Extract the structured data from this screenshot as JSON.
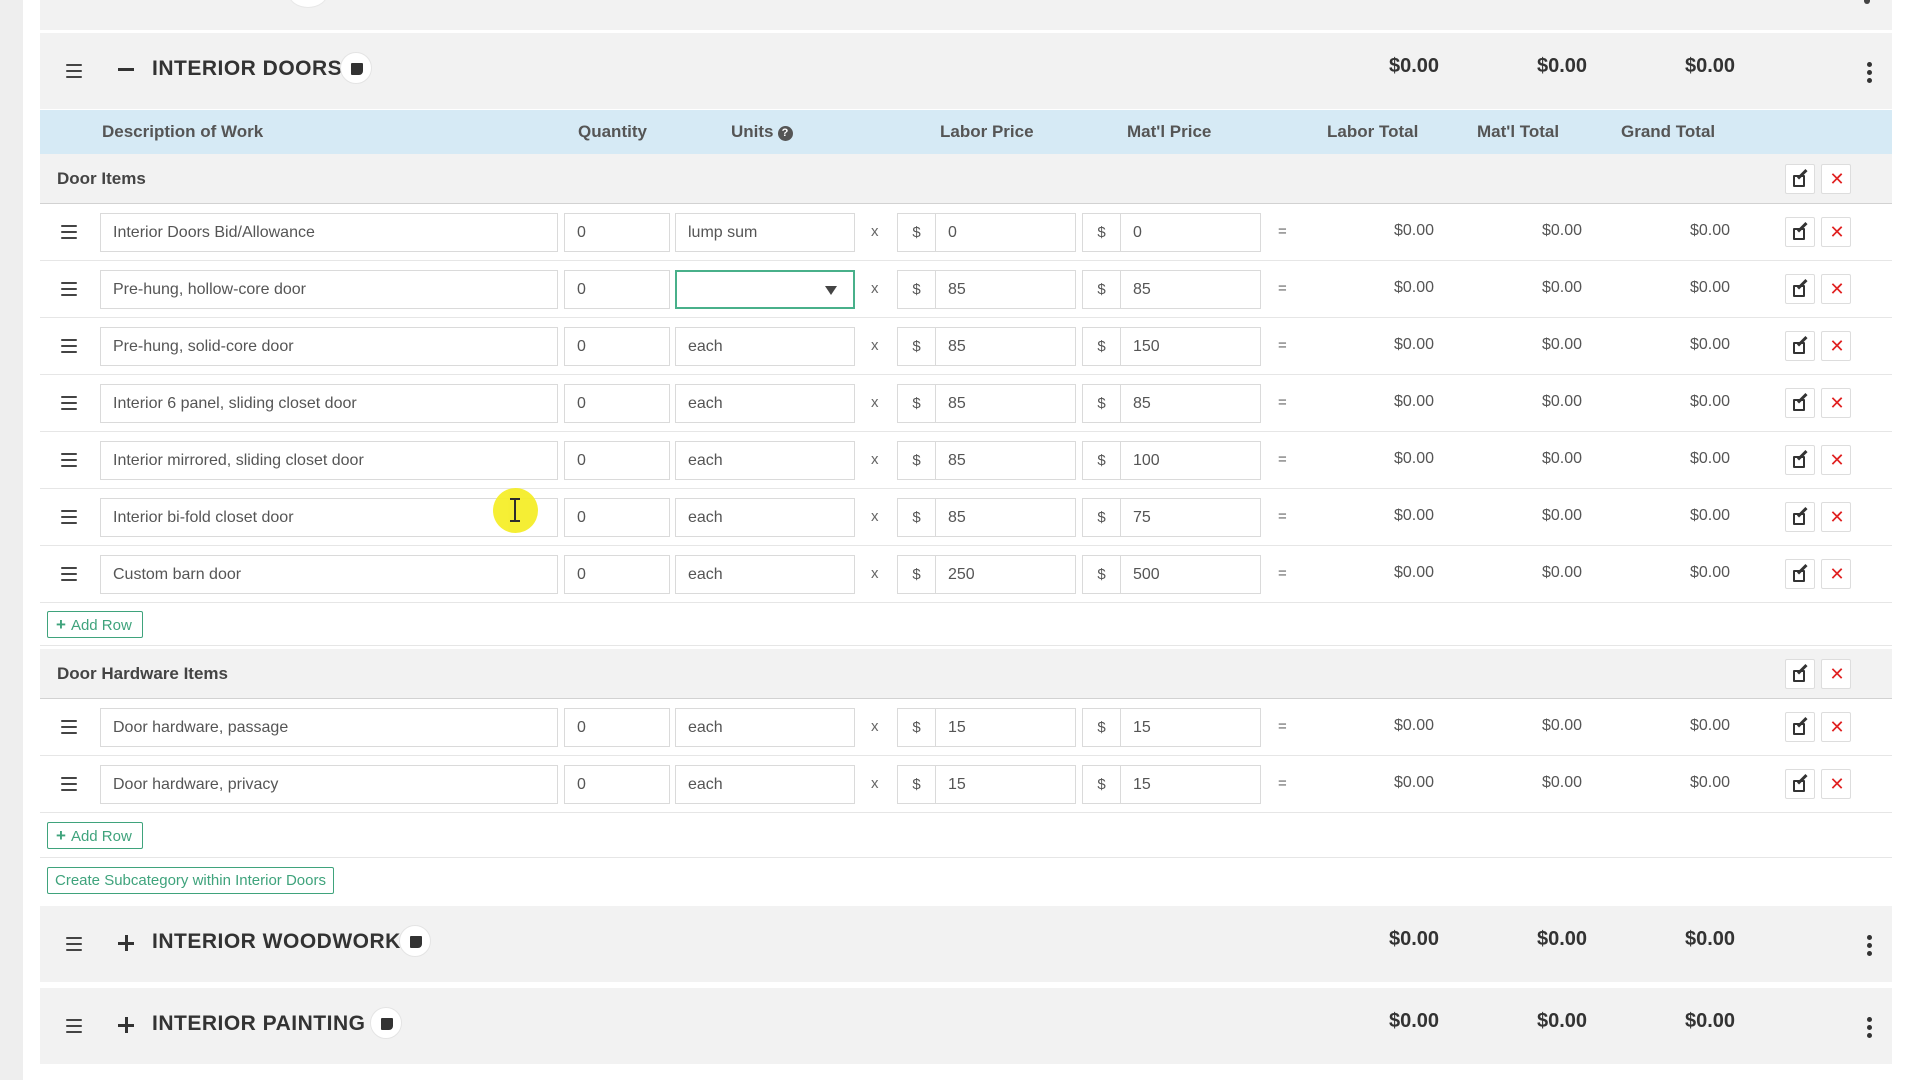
{
  "categories": {
    "interior_doors": {
      "title": "INTERIOR DOORS",
      "labor_total": "$0.00",
      "matl_total": "$0.00",
      "grand_total": "$0.00"
    },
    "interior_woodwork": {
      "title": "INTERIOR WOODWORK",
      "labor_total": "$0.00",
      "matl_total": "$0.00",
      "grand_total": "$0.00"
    },
    "interior_painting": {
      "title": "INTERIOR PAINTING",
      "labor_total": "$0.00",
      "matl_total": "$0.00",
      "grand_total": "$0.00"
    }
  },
  "columns": {
    "description": "Description of Work",
    "quantity": "Quantity",
    "units": "Units",
    "labor_price": "Labor Price",
    "matl_price": "Mat'l Price",
    "labor_total": "Labor Total",
    "matl_total": "Mat'l Total",
    "grand_total": "Grand Total"
  },
  "symbols": {
    "times": "x",
    "equals": "=",
    "dollar": "$",
    "delete": "✕",
    "plus": "+"
  },
  "subcategories": {
    "door_items": {
      "title": "Door Items",
      "rows": [
        {
          "description": "Interior Doors Bid/Allowance",
          "quantity": "0",
          "units": "lump sum",
          "labor_price": "0",
          "matl_price": "0",
          "labor_total": "$0.00",
          "matl_total": "$0.00",
          "grand_total": "$0.00"
        },
        {
          "description": "Pre-hung, hollow-core door",
          "quantity": "0",
          "units": "",
          "labor_price": "85",
          "matl_price": "85",
          "labor_total": "$0.00",
          "matl_total": "$0.00",
          "grand_total": "$0.00"
        },
        {
          "description": "Pre-hung, solid-core door",
          "quantity": "0",
          "units": "each",
          "labor_price": "85",
          "matl_price": "150",
          "labor_total": "$0.00",
          "matl_total": "$0.00",
          "grand_total": "$0.00"
        },
        {
          "description": "Interior 6 panel, sliding closet door",
          "quantity": "0",
          "units": "each",
          "labor_price": "85",
          "matl_price": "85",
          "labor_total": "$0.00",
          "matl_total": "$0.00",
          "grand_total": "$0.00"
        },
        {
          "description": "Interior mirrored, sliding closet door",
          "quantity": "0",
          "units": "each",
          "labor_price": "85",
          "matl_price": "100",
          "labor_total": "$0.00",
          "matl_total": "$0.00",
          "grand_total": "$0.00"
        },
        {
          "description": "Interior bi-fold closet door",
          "quantity": "0",
          "units": "each",
          "labor_price": "85",
          "matl_price": "75",
          "labor_total": "$0.00",
          "matl_total": "$0.00",
          "grand_total": "$0.00"
        },
        {
          "description": "Custom barn door",
          "quantity": "0",
          "units": "each",
          "labor_price": "250",
          "matl_price": "500",
          "labor_total": "$0.00",
          "matl_total": "$0.00",
          "grand_total": "$0.00"
        }
      ]
    },
    "door_hardware_items": {
      "title": "Door Hardware Items",
      "rows": [
        {
          "description": "Door hardware, passage",
          "quantity": "0",
          "units": "each",
          "labor_price": "15",
          "matl_price": "15",
          "labor_total": "$0.00",
          "matl_total": "$0.00",
          "grand_total": "$0.00"
        },
        {
          "description": "Door hardware, privacy",
          "quantity": "0",
          "units": "each",
          "labor_price": "15",
          "matl_price": "15",
          "labor_total": "$0.00",
          "matl_total": "$0.00",
          "grand_total": "$0.00"
        }
      ]
    }
  },
  "buttons": {
    "add_row": "Add Row",
    "create_subcategory": "Create Subcategory within Interior Doors"
  },
  "colors": {
    "header_blue": "#d6eaf5",
    "accent_green": "#3fa37c",
    "delete_red": "#e02020",
    "cursor_highlight": "#f5ee2a"
  }
}
